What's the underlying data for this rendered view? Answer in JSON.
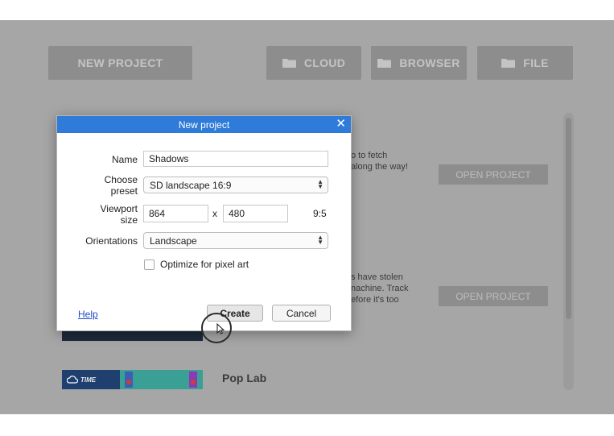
{
  "toolbar": {
    "new_project": "NEW PROJECT",
    "cloud": "CLOUD",
    "browser": "BROWSER",
    "file": "FILE",
    "icon": "folder-icon"
  },
  "projects": [
    {
      "desc_line1": "o to fetch",
      "desc_line2": "along the way!",
      "open_label": "OPEN PROJECT"
    },
    {
      "desc_line1": "s have stolen",
      "desc_line2": "nachine. Track",
      "desc_line3": "efore it's too",
      "open_label": "OPEN PROJECT"
    }
  ],
  "poplab": {
    "title": "Pop Lab",
    "thumb_text": "TIME"
  },
  "dialog": {
    "title": "New project",
    "close_icon": "✕",
    "name_label": "Name",
    "name_value": "Shadows",
    "preset_label_1": "Choose",
    "preset_label_2": "preset",
    "preset_value": "SD landscape 16:9",
    "viewport_label_1": "Viewport",
    "viewport_label_2": "size",
    "viewport_width": "864",
    "viewport_x": "x",
    "viewport_height": "480",
    "aspect": "9:5",
    "orientation_label": "Orientations",
    "orientation_value": "Landscape",
    "pixel_art_label": "Optimize for pixel art",
    "help_label": "Help",
    "create_label": "Create",
    "cancel_label": "Cancel"
  },
  "colors": {
    "overlay": "#a6a6a6",
    "titlebar": "#2f7bd9",
    "link": "#2348c8"
  }
}
